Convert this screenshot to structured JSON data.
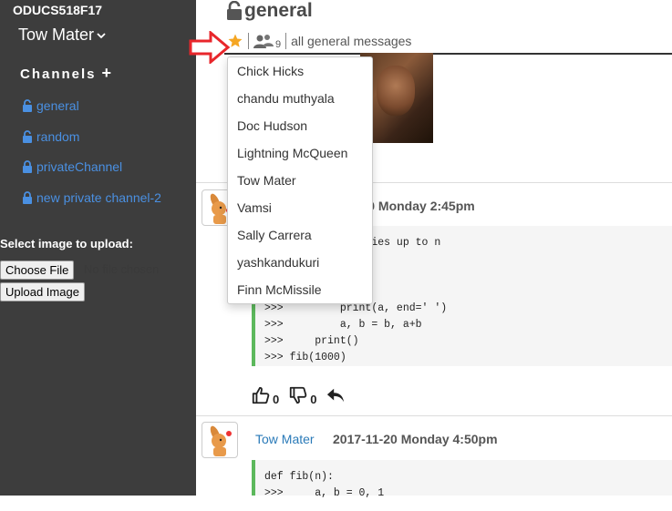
{
  "sidebar": {
    "team_name": "ODUCS518F17",
    "user_name": "Tow Mater",
    "channels_heading": "Channels",
    "channels": [
      {
        "name": "general",
        "locked": false
      },
      {
        "name": "random",
        "locked": false
      },
      {
        "name": "privateChannel",
        "locked": true
      },
      {
        "name": "new private channel-2",
        "locked": true
      }
    ],
    "upload_label": "Select image to upload:",
    "choose_file_label": "Choose File",
    "no_file_text": "No file chosen",
    "upload_button_label": "Upload Image"
  },
  "header": {
    "channel_title": "general",
    "member_count": "9",
    "description": "all general messages"
  },
  "members_dropdown": [
    "Chick Hicks",
    "chandu muthyala",
    "Doc Hudson",
    "Lightning McQueen",
    "Tow Mater",
    "Vamsi",
    "Sally Carrera",
    "yashkandukuri",
    "Finn McMissile"
  ],
  "messages": [
    {
      "author": "",
      "time_visible": "1-20 Monday 2:45pm",
      "code": "        nacci series up to n\n\n              1\n             n:\n>>>         print(a, end=' ')\n>>>         a, b = b, a+b\n>>>     print()\n>>> fib(1000)",
      "likes": "0",
      "dislikes": "0"
    },
    {
      "author": "Tow Mater",
      "time": "2017-11-20 Monday 4:50pm",
      "code": "def fib(n):\n>>>     a, b = 0, 1"
    }
  ],
  "colors": {
    "sidebar_bg": "#3d3d3d",
    "channel_link": "#4a90e2",
    "code_border": "#5cb85c",
    "arrow": "#e8262b",
    "star": "#f5a623"
  }
}
